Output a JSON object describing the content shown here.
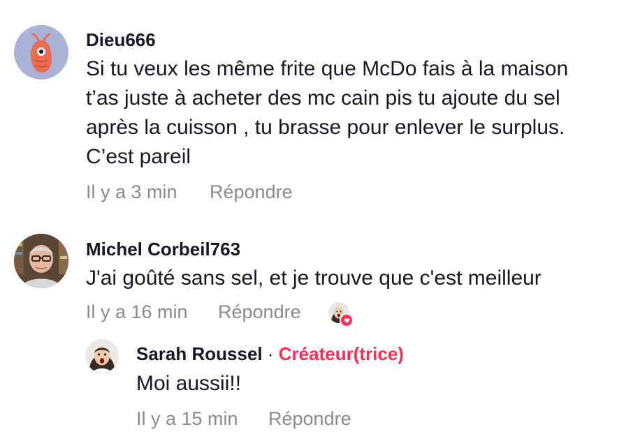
{
  "comments": [
    {
      "username": "Dieu666",
      "lines": [
        "Si tu veux les même frite que McDo fais à la maison",
        "t’as juste à acheter des mc cain pis tu ajoute du sel",
        "après la cuisson , tu brasse pour enlever le surplus.",
        "C’est pareil"
      ],
      "time": "Il y a 3 min",
      "reply_label": "Répondre"
    },
    {
      "username": "Michel Corbeil763",
      "text": "J'ai goûté sans sel, et je trouve que c'est meilleur",
      "time": "Il y a 16 min",
      "reply_label": "Répondre",
      "liked_by_creator": true
    }
  ],
  "reply": {
    "username": "Sarah Roussel",
    "separator": "·",
    "creator_label": "Créateur(trice)",
    "text": "Moi aussii!!",
    "time": "Il y a 15 min",
    "reply_label": "Répondre"
  },
  "colors": {
    "accent": "#fe2c55",
    "muted": "#8a8b91",
    "text": "#161823"
  }
}
